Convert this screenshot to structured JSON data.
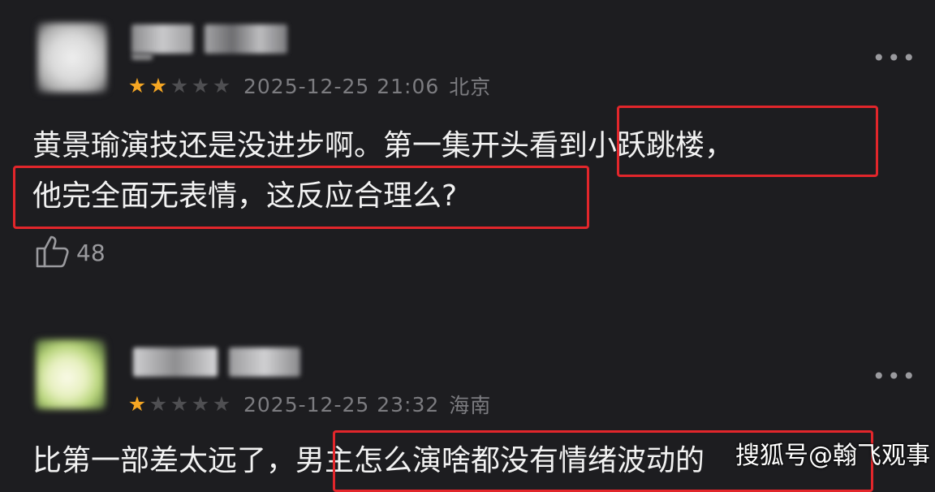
{
  "comments": [
    {
      "stars_on": 2,
      "stars_total": 5,
      "datetime": "2025-12-25 21:06",
      "location": "北京",
      "text_line1": "黄景瑜演技还是没进步啊。第一集开头看到小跃跳楼，",
      "text_line2": "他完全面无表情，这反应合理么?",
      "likes": "48",
      "more": "•••"
    },
    {
      "stars_on": 1,
      "stars_total": 5,
      "datetime": "2025-12-25 23:32",
      "location": "海南",
      "text_line1": "比第一部差太远了，男主怎么演啥都没有情绪波动的",
      "more": "•••"
    }
  ],
  "watermark": "搜狐号@翰飞观事",
  "colors": {
    "background": "#1d1d20",
    "star_on": "#f5a623",
    "highlight": "#e2262b",
    "meta": "#7c7c80"
  }
}
